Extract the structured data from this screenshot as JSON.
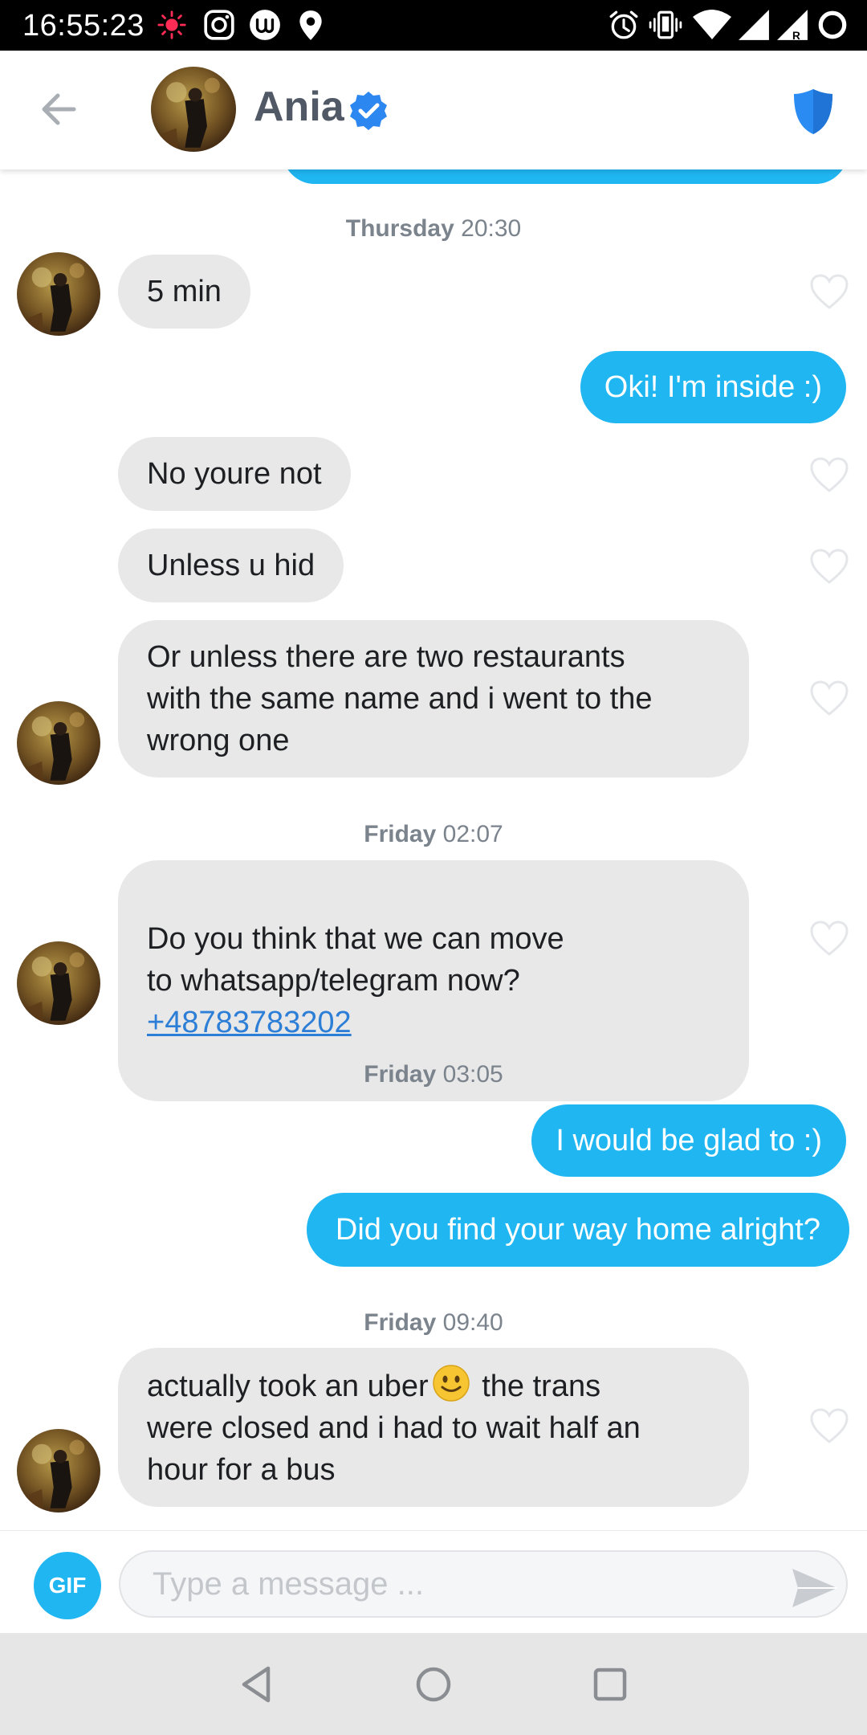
{
  "status_bar": {
    "time": "16:55:23",
    "left_icons": [
      "recording-dot-icon",
      "instagram-icon",
      "app-notification-icon",
      "location-pin-icon"
    ],
    "right_icons": [
      "alarm-icon",
      "vibrate-icon",
      "wifi-icon",
      "signal-icon",
      "signal-roaming-icon",
      "battery-ring-icon"
    ],
    "roaming_label": "R"
  },
  "header": {
    "contact_name": "Ania",
    "verified": true,
    "back_icon": "back-arrow-icon",
    "shield_icon": "shield-icon"
  },
  "colors": {
    "accent_blue": "#1fb6f2",
    "incoming_bubble": "#e8e8e9",
    "link_blue": "#2c7ed6",
    "verified_blue": "#2d87f0",
    "shield_blue": "#2a8bf2"
  },
  "conversation": {
    "timestamps": [
      {
        "day": "Thursday",
        "time": "20:30"
      },
      {
        "day": "Friday",
        "time": "02:07"
      },
      {
        "day": "Friday",
        "time": "03:05"
      },
      {
        "day": "Friday",
        "time": "09:40"
      }
    ],
    "messages": [
      {
        "sender": "them",
        "text": "5 min"
      },
      {
        "sender": "me",
        "text": "Oki! I'm inside :)"
      },
      {
        "sender": "them",
        "text": "No youre not"
      },
      {
        "sender": "them",
        "text": "Unless u hid"
      },
      {
        "sender": "them",
        "text": "Or unless there are two restaurants\nwith the same name and i went to the\nwrong one"
      },
      {
        "sender": "them",
        "text": "Do you think that we can move\nto whatsapp/telegram now?",
        "link": "+48783783202"
      },
      {
        "sender": "me",
        "text": "I would be glad to :)"
      },
      {
        "sender": "me",
        "text": "Did you find your way home alright?"
      },
      {
        "sender": "them",
        "text_before_emoji": "actually took an uber",
        "emoji": "slightly-smiling-face",
        "text_after_emoji": " the trans\nwere closed and i had to wait half an\nhour for a bus"
      }
    ]
  },
  "composer": {
    "gif_label": "GIF",
    "placeholder": "Type a message ...",
    "send_icon": "send-icon"
  },
  "nav_bar": {
    "buttons": [
      "back-triangle-icon",
      "home-circle-icon",
      "recents-square-icon"
    ]
  }
}
